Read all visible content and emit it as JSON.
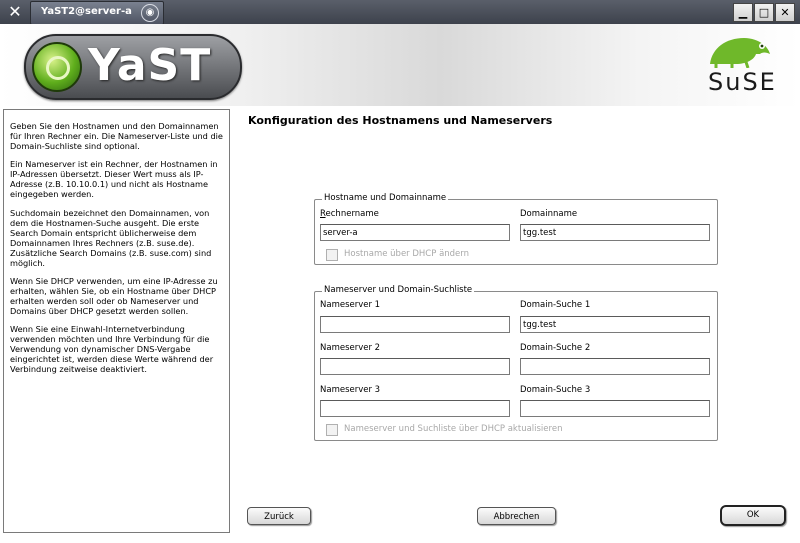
{
  "window": {
    "title": "YaST2@server-a",
    "buttons": [
      "minimize",
      "maximize",
      "close"
    ]
  },
  "banner": {
    "yast_logo_text": "YaST",
    "suse_logo_text": "SuSE"
  },
  "help": {
    "paragraphs": [
      "Geben Sie den Hostnamen und den Domainnamen für Ihren Rechner ein. Die Nameserver-Liste und die Domain-Suchliste sind optional.",
      "Ein Nameserver ist ein Rechner, der Hostnamen in IP-Adressen übersetzt. Dieser Wert muss als IP-Adresse (z.B. 10.10.0.1) und nicht als Hostname eingegeben werden.",
      "Suchdomain bezeichnet den Domainnamen, von dem die Hostnamen-Suche ausgeht. Die erste Search Domain entspricht üblicherweise dem Domainnamen Ihres Rechners (z.B. suse.de). Zusätzliche Search Domains (z.B. suse.com) sind möglich.",
      "Wenn Sie DHCP verwenden, um eine IP-Adresse zu erhalten, wählen Sie, ob ein Hostname über DHCP erhalten werden soll oder ob Nameserver und Domains über DHCP gesetzt werden sollen.",
      "Wenn Sie eine Einwahl-Internetverbindung verwenden möchten und Ihre Verbindung für die Verwendung von dynamischer DNS-Vergabe eingerichtet ist, werden diese Werte während der Verbindung zeitweise deaktiviert."
    ]
  },
  "main": {
    "title": "Konfiguration des Hostnamens und Nameservers",
    "host_frame": {
      "legend": "Hostname und Domainname",
      "hostname_label": "Rechnername",
      "hostname_value": "server-a",
      "domain_label": "Domainname",
      "domain_value": "tgg.test",
      "dhcp_checkbox_label": "Hostname über DHCP ändern"
    },
    "ns_frame": {
      "legend": "Nameserver und Domain-Suchliste",
      "ns1_label": "Nameserver 1",
      "ns1_value": "",
      "ns2_label": "Nameserver 2",
      "ns2_value": "",
      "ns3_label": "Nameserver 3",
      "ns3_value": "",
      "ds1_label": "Domain-Suche 1",
      "ds1_value": "tgg.test",
      "ds2_label": "Domain-Suche 2",
      "ds2_value": "",
      "ds3_label": "Domain-Suche 3",
      "ds3_value": "",
      "dhcp_checkbox_label": "Nameserver und Suchliste über DHCP aktualisieren"
    }
  },
  "footer": {
    "back_label": "Zurück",
    "cancel_label": "Abbrechen",
    "ok_label": "OK"
  }
}
